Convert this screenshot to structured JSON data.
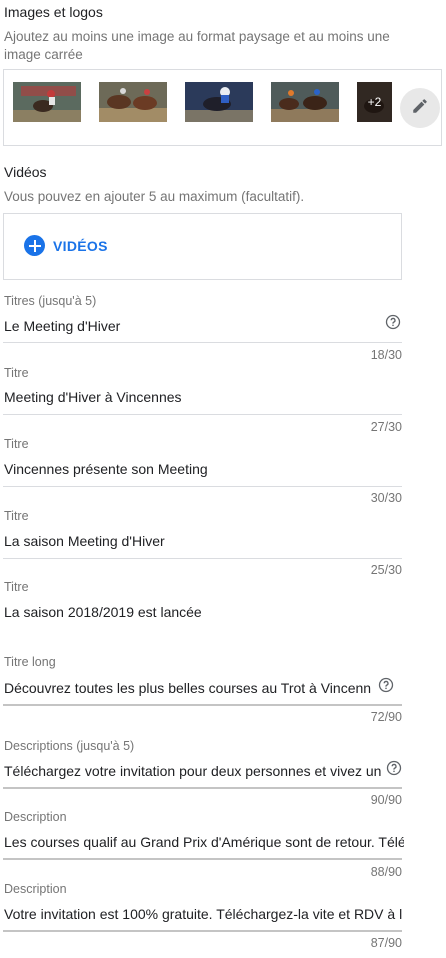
{
  "images": {
    "title": "Images et logos",
    "hint": "Ajoutez au moins une image au format paysage et au moins une image carrée",
    "thumbnails": [
      {
        "icon": "horse-race-image-1"
      },
      {
        "icon": "horse-race-image-2"
      },
      {
        "icon": "horse-race-image-3"
      },
      {
        "icon": "horse-race-image-4"
      },
      {
        "icon": "horse-race-image-5"
      }
    ],
    "more_count": "+2",
    "edit_icon": "pencil-icon"
  },
  "videos": {
    "title": "Vidéos",
    "hint": "Vous pouvez en ajouter 5 au maximum (facultatif).",
    "add_label": "VIDÉOS",
    "accent": "#1a73e8"
  },
  "headlines": [
    {
      "label": "Titres (jusqu'à 5)",
      "value": "Le Meeting d'Hiver",
      "counter": "18/30",
      "help": true
    },
    {
      "label": "Titre",
      "value": "Meeting d'Hiver à Vincennes",
      "counter": "27/30"
    },
    {
      "label": "Titre",
      "value": "Vincennes présente son Meeting",
      "counter": "30/30"
    },
    {
      "label": "Titre",
      "value": "La saison Meeting d'Hiver",
      "counter": "25/30"
    },
    {
      "label": "Titre",
      "value": "La saison 2018/2019 est lancée",
      "counter": ""
    }
  ],
  "long_headline": {
    "label": "Titre long",
    "value": "Découvrez toutes les plus belles courses au Trot à Vincenn",
    "counter": "72/90"
  },
  "descriptions": [
    {
      "label": "Descriptions (jusqu'à 5)",
      "value": "Téléchargez votre invitation pour deux personnes et vivez un",
      "counter": "90/90",
      "help": true
    },
    {
      "label": "Description",
      "value": "Les courses qualif au Grand Prix d'Amérique sont de retour. Télé",
      "counter": "88/90"
    },
    {
      "label": "Description",
      "value": "Votre invitation est 100% gratuite. Téléchargez-la vite et RDV à l",
      "counter": "87/90"
    }
  ]
}
